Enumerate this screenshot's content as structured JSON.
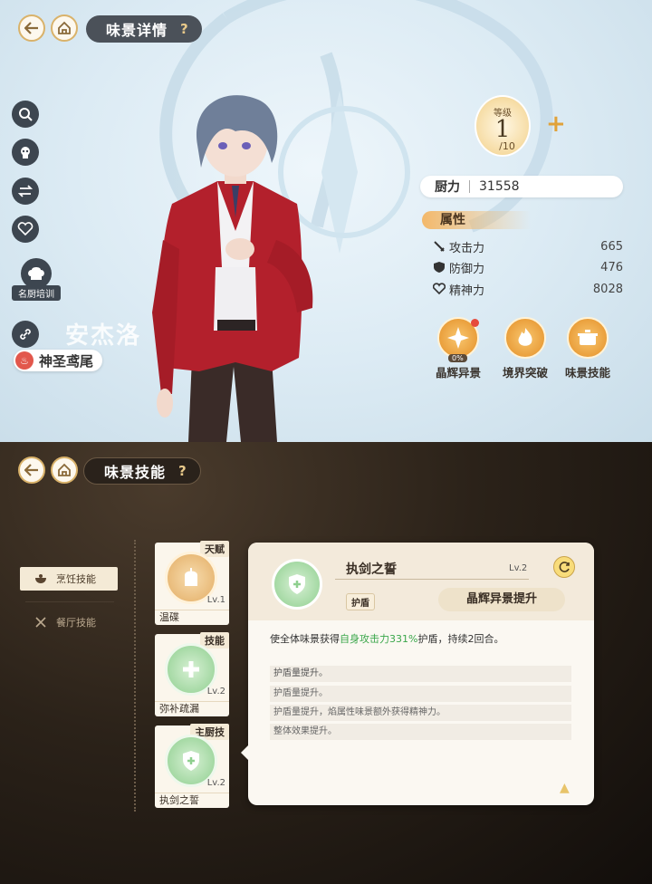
{
  "top": {
    "title": "味景详情",
    "help": "?",
    "side_icons": [
      {
        "icon": "search-icon"
      },
      {
        "icon": "skull-icon"
      },
      {
        "icon": "swap-icon"
      },
      {
        "icon": "heart-plus-icon"
      }
    ],
    "chef_training": "名厨培训",
    "link_icon": "link-icon",
    "character_name_en": "安杰洛",
    "dish_name": "神圣鸢尾",
    "level": {
      "label": "等级",
      "current": "1",
      "max": "10"
    },
    "level_plus": "+",
    "cooking_power": {
      "label": "厨力",
      "value": "31558"
    },
    "attributes": {
      "header": "属性",
      "rows": [
        {
          "icon": "sword-icon",
          "label": "攻击力",
          "value": "665"
        },
        {
          "icon": "shield-icon",
          "label": "防御力",
          "value": "476"
        },
        {
          "icon": "heart-icon",
          "label": "精神力",
          "value": "8028"
        }
      ]
    },
    "actions": [
      {
        "label": "晶辉异景",
        "sub": "0%"
      },
      {
        "label": "境界突破"
      },
      {
        "label": "味景技能"
      }
    ]
  },
  "bottom": {
    "title": "味景技能",
    "help": "?",
    "tabs": [
      {
        "label": "烹饪技能",
        "active": true
      },
      {
        "label": "餐厅技能",
        "active": false
      }
    ],
    "skills": [
      {
        "badge": "天赋",
        "name": "温碟",
        "level": "Lv.1",
        "color": "#e8b36a"
      },
      {
        "badge": "技能",
        "name": "弥补疏漏",
        "level": "Lv.2",
        "color": "#8fcf8f"
      },
      {
        "badge": "主厨技",
        "name": "执剑之誓",
        "level": "Lv.2",
        "color": "#8fcf8f"
      }
    ],
    "detail": {
      "name": "执剑之誓",
      "level": "Lv.2",
      "tag": "护盾",
      "upgrade_label": "晶辉异景提升",
      "desc_prefix": "使全体味景获得",
      "desc_highlight": "自身攻击力331%",
      "desc_suffix": "护盾，持续2回合。",
      "effects": [
        "护盾量提升。",
        "护盾量提升。",
        "护盾量提升，焰属性味景额外获得精神力。",
        "整体效果提升。"
      ],
      "more": "▲"
    }
  }
}
